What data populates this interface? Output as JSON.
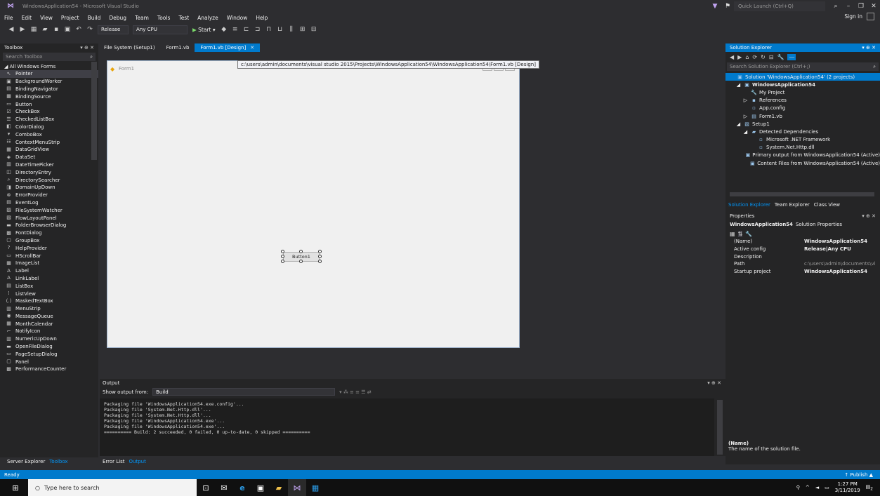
{
  "window": {
    "title": "WindowsApplication54 - Microsoft Visual Studio",
    "quick_launch_placeholder": "Quick Launch (Ctrl+Q)",
    "sign_in": "Sign in"
  },
  "menu": [
    "File",
    "Edit",
    "View",
    "Project",
    "Build",
    "Debug",
    "Team",
    "Tools",
    "Test",
    "Analyze",
    "Window",
    "Help"
  ],
  "toolbar": {
    "config": "Release",
    "platform": "Any CPU",
    "start": "Start"
  },
  "toolbox": {
    "title": "Toolbox",
    "search_placeholder": "Search Toolbox",
    "group": "All Windows Forms",
    "items": [
      {
        "icon": "↖",
        "label": "Pointer"
      },
      {
        "icon": "▣",
        "label": "BackgroundWorker"
      },
      {
        "icon": "▤",
        "label": "BindingNavigator"
      },
      {
        "icon": "▦",
        "label": "BindingSource"
      },
      {
        "icon": "▭",
        "label": "Button"
      },
      {
        "icon": "☑",
        "label": "CheckBox"
      },
      {
        "icon": "☰",
        "label": "CheckedListBox"
      },
      {
        "icon": "◧",
        "label": "ColorDialog"
      },
      {
        "icon": "▾",
        "label": "ComboBox"
      },
      {
        "icon": "☷",
        "label": "ContextMenuStrip"
      },
      {
        "icon": "▦",
        "label": "DataGridView"
      },
      {
        "icon": "◈",
        "label": "DataSet"
      },
      {
        "icon": "▥",
        "label": "DateTimePicker"
      },
      {
        "icon": "◫",
        "label": "DirectoryEntry"
      },
      {
        "icon": "⌕",
        "label": "DirectorySearcher"
      },
      {
        "icon": "◨",
        "label": "DomainUpDown"
      },
      {
        "icon": "⊗",
        "label": "ErrorProvider"
      },
      {
        "icon": "▤",
        "label": "EventLog"
      },
      {
        "icon": "▨",
        "label": "FileSystemWatcher"
      },
      {
        "icon": "▧",
        "label": "FlowLayoutPanel"
      },
      {
        "icon": "▬",
        "label": "FolderBrowserDialog"
      },
      {
        "icon": "▩",
        "label": "FontDialog"
      },
      {
        "icon": "▢",
        "label": "GroupBox"
      },
      {
        "icon": "?",
        "label": "HelpProvider"
      },
      {
        "icon": "▭",
        "label": "HScrollBar"
      },
      {
        "icon": "▦",
        "label": "ImageList"
      },
      {
        "icon": "A",
        "label": "Label"
      },
      {
        "icon": "A",
        "label": "LinkLabel"
      },
      {
        "icon": "▤",
        "label": "ListBox"
      },
      {
        "icon": "⁞",
        "label": "ListView"
      },
      {
        "icon": "(.)",
        "label": "MaskedTextBox"
      },
      {
        "icon": "▥",
        "label": "MenuStrip"
      },
      {
        "icon": "◉",
        "label": "MessageQueue"
      },
      {
        "icon": "▦",
        "label": "MonthCalendar"
      },
      {
        "icon": "⌐",
        "label": "NotifyIcon"
      },
      {
        "icon": "▥",
        "label": "NumericUpDown"
      },
      {
        "icon": "▬",
        "label": "OpenFileDialog"
      },
      {
        "icon": "▭",
        "label": "PageSetupDialog"
      },
      {
        "icon": "▢",
        "label": "Panel"
      },
      {
        "icon": "▩",
        "label": "PerformanceCounter"
      }
    ],
    "tabs": [
      "Server Explorer",
      "Toolbox"
    ]
  },
  "doc_tabs": [
    {
      "label": "File System (Setup1)",
      "active": false
    },
    {
      "label": "Form1.vb",
      "active": false
    },
    {
      "label": "Form1.vb [Design]",
      "active": true
    }
  ],
  "tooltip": "c:\\users\\admin\\documents\\visual studio 2015\\Projects\\WindowsApplication54\\WindowsApplication54\\Form1.vb [Design]",
  "designer": {
    "form_title": "Form1",
    "button_label": "Button1"
  },
  "output": {
    "title": "Output",
    "show_from_label": "Show output from:",
    "show_from_value": "Build",
    "lines": [
      "Packaging file 'WindowsApplication54.exe.config'...",
      "Packaging file 'System.Net.Http.dll'...",
      "Packaging file 'System.Net.Http.dll'...",
      "Packaging file 'WindowsApplication54.exe'...",
      "Packaging file 'WindowsApplication54.exe'...",
      "========== Build: 2 succeeded, 0 failed, 0 up-to-date, 0 skipped =========="
    ],
    "tabs": [
      "Error List",
      "Output"
    ]
  },
  "solution_explorer": {
    "title": "Solution Explorer",
    "search_placeholder": "Search Solution Explorer (Ctrl+;)",
    "tree": [
      {
        "indent": 0,
        "arrow": "",
        "icon": "▣",
        "label": "Solution 'WindowsApplication54' (2 projects)",
        "selected": true,
        "bold": false
      },
      {
        "indent": 1,
        "arrow": "◢",
        "icon": "▣",
        "label": "WindowsApplication54",
        "selected": false,
        "bold": true
      },
      {
        "indent": 2,
        "arrow": "",
        "icon": "🔧",
        "label": "My Project",
        "selected": false,
        "bold": false
      },
      {
        "indent": 2,
        "arrow": "▷",
        "icon": "▪",
        "label": "References",
        "selected": false,
        "bold": false
      },
      {
        "indent": 2,
        "arrow": "",
        "icon": "▫",
        "label": "App.config",
        "selected": false,
        "bold": false
      },
      {
        "indent": 2,
        "arrow": "▷",
        "icon": "▤",
        "label": "Form1.vb",
        "selected": false,
        "bold": false
      },
      {
        "indent": 1,
        "arrow": "◢",
        "icon": "▧",
        "label": "Setup1",
        "selected": false,
        "bold": false
      },
      {
        "indent": 2,
        "arrow": "◢",
        "icon": "▰",
        "label": "Detected Dependencies",
        "selected": false,
        "bold": false
      },
      {
        "indent": 3,
        "arrow": "",
        "icon": "▫",
        "label": "Microsoft .NET Framework",
        "selected": false,
        "bold": false
      },
      {
        "indent": 3,
        "arrow": "",
        "icon": "▫",
        "label": "System.Net.Http.dll",
        "selected": false,
        "bold": false
      },
      {
        "indent": 2,
        "arrow": "",
        "icon": "▣",
        "label": "Primary output from WindowsApplication54 (Active)",
        "selected": false,
        "bold": false
      },
      {
        "indent": 2,
        "arrow": "",
        "icon": "▣",
        "label": "Content Files from WindowsApplication54 (Active)",
        "selected": false,
        "bold": false
      }
    ],
    "tabs": [
      "Solution Explorer",
      "Team Explorer",
      "Class View"
    ]
  },
  "properties": {
    "title": "Properties",
    "object": "WindowsApplication54",
    "object_type": "Solution Properties",
    "rows": [
      {
        "key": "(Name)",
        "value": "WindowsApplication54",
        "bold": true
      },
      {
        "key": "Active config",
        "value": "Release|Any CPU",
        "bold": true
      },
      {
        "key": "Description",
        "value": "",
        "bold": false
      },
      {
        "key": "Path",
        "value": "c:\\users\\admin\\documents\\vi",
        "bold": false
      },
      {
        "key": "Startup project",
        "value": "WindowsApplication54",
        "bold": true
      }
    ],
    "desc_title": "(Name)",
    "desc_text": "The name of the solution file."
  },
  "status": {
    "text": "Ready",
    "publish": "↑ Publish ▲"
  },
  "taskbar": {
    "search_placeholder": "Type here to search",
    "time": "1:27 PM",
    "date": "3/11/2019",
    "notif_count": "2"
  },
  "colors": {
    "accent": "#007acc",
    "background": "#2d2d30",
    "panel": "#252526"
  }
}
